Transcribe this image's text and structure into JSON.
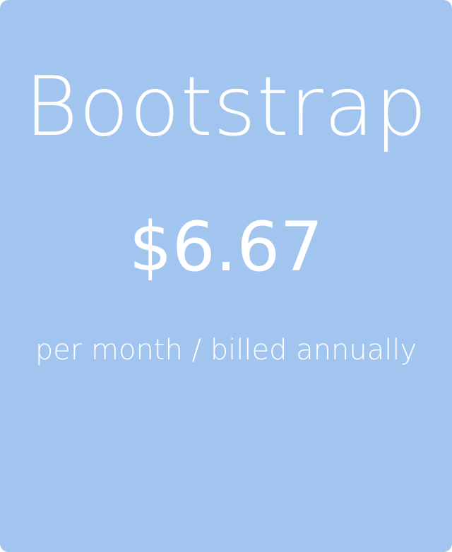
{
  "plan": {
    "name": "Bootstrap",
    "price": "$6.67",
    "billing": "per month / billed annually"
  },
  "colors": {
    "card_background": "#a2c5ef",
    "text": "#ffffff"
  }
}
